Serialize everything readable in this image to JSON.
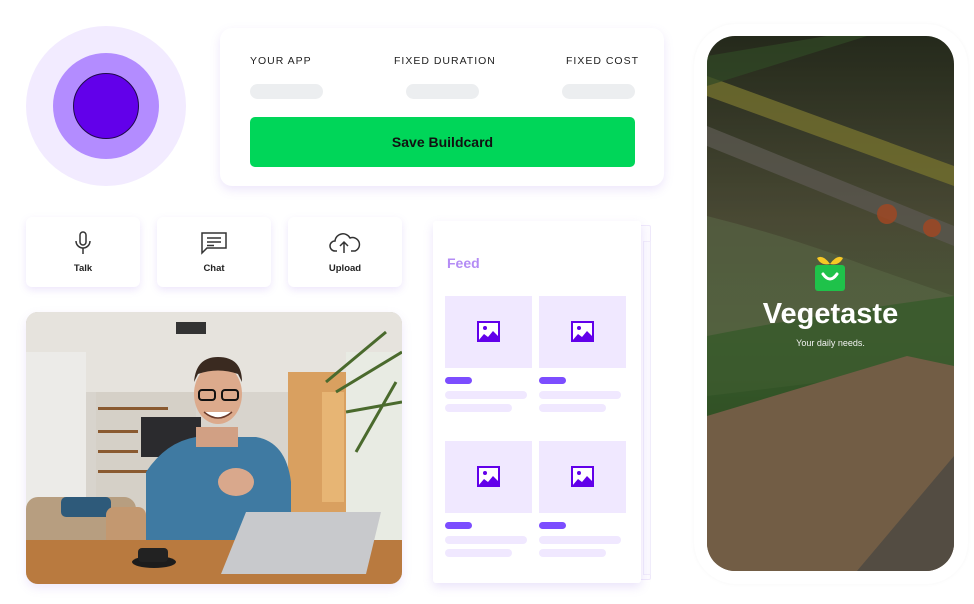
{
  "record_button": {
    "icon": "record-icon",
    "colors": {
      "outer": "#f2ebff",
      "middle": "#b38cff",
      "inner": "#6200ea"
    }
  },
  "buildcard": {
    "columns": [
      "YOUR APP",
      "FIXED DURATION",
      "FIXED COST"
    ],
    "save_label": "Save Buildcard",
    "accent": "#00d659"
  },
  "actions": [
    {
      "label": "Talk",
      "icon": "microphone-icon"
    },
    {
      "label": "Chat",
      "icon": "chat-icon"
    },
    {
      "label": "Upload",
      "icon": "cloud-upload-icon"
    }
  ],
  "photo": {
    "description": "Smiling man with glasses at laptop in living room"
  },
  "feed": {
    "title": "Feed",
    "items": [
      {
        "icon": "image-icon"
      },
      {
        "icon": "image-icon"
      },
      {
        "icon": "image-icon"
      },
      {
        "icon": "image-icon"
      }
    ],
    "accent": "#7c4dff"
  },
  "phone": {
    "app_name": "Vegetaste",
    "tagline": "Your daily needs.",
    "logo_icon": "basket-smile-icon"
  }
}
